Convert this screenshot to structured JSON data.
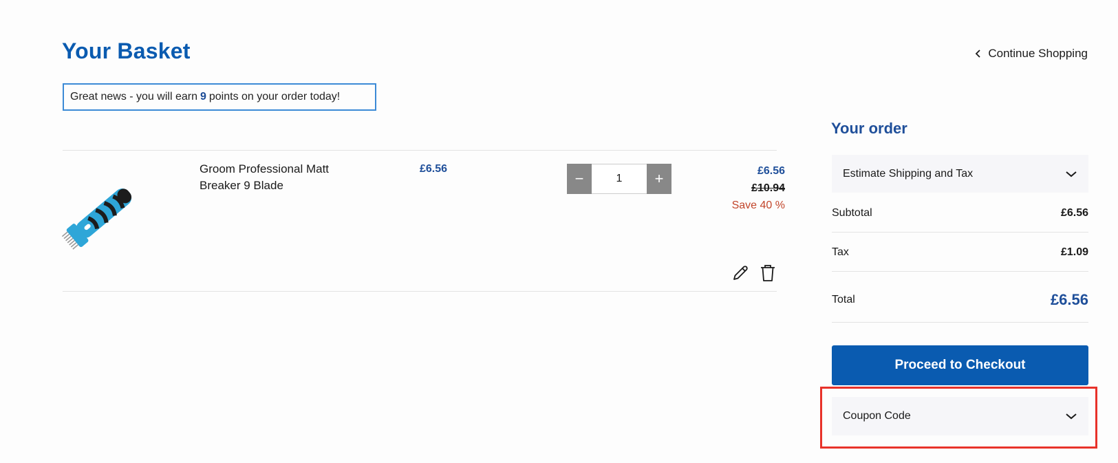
{
  "header": {
    "title": "Your Basket",
    "continue_label": "Continue Shopping"
  },
  "points": {
    "prefix": "Great news - you will earn",
    "value": "9",
    "suffix": "points on your order today!"
  },
  "cart": {
    "items": [
      {
        "name": "Groom Professional Matt Breaker 9 Blade",
        "unit_price": "£6.56",
        "quantity": "1",
        "price_now": "£6.56",
        "price_was": "£10.94",
        "save": "Save 40 %"
      }
    ],
    "decrement_symbol": "−",
    "increment_symbol": "+"
  },
  "order": {
    "title": "Your order",
    "estimate_label": "Estimate Shipping and Tax",
    "subtotal_label": "Subtotal",
    "subtotal_value": "£6.56",
    "tax_label": "Tax",
    "tax_value": "£1.09",
    "total_label": "Total",
    "total_value": "£6.56",
    "checkout_label": "Proceed to Checkout",
    "coupon_label": "Coupon Code"
  },
  "colors": {
    "brand_blue": "#0a5bb0",
    "price_blue": "#1f4f9a",
    "save_red": "#c2452a",
    "highlight_red": "#e8322a"
  },
  "icons": [
    "chevron-left-icon",
    "chevron-down-icon",
    "pencil-icon",
    "trash-icon"
  ]
}
